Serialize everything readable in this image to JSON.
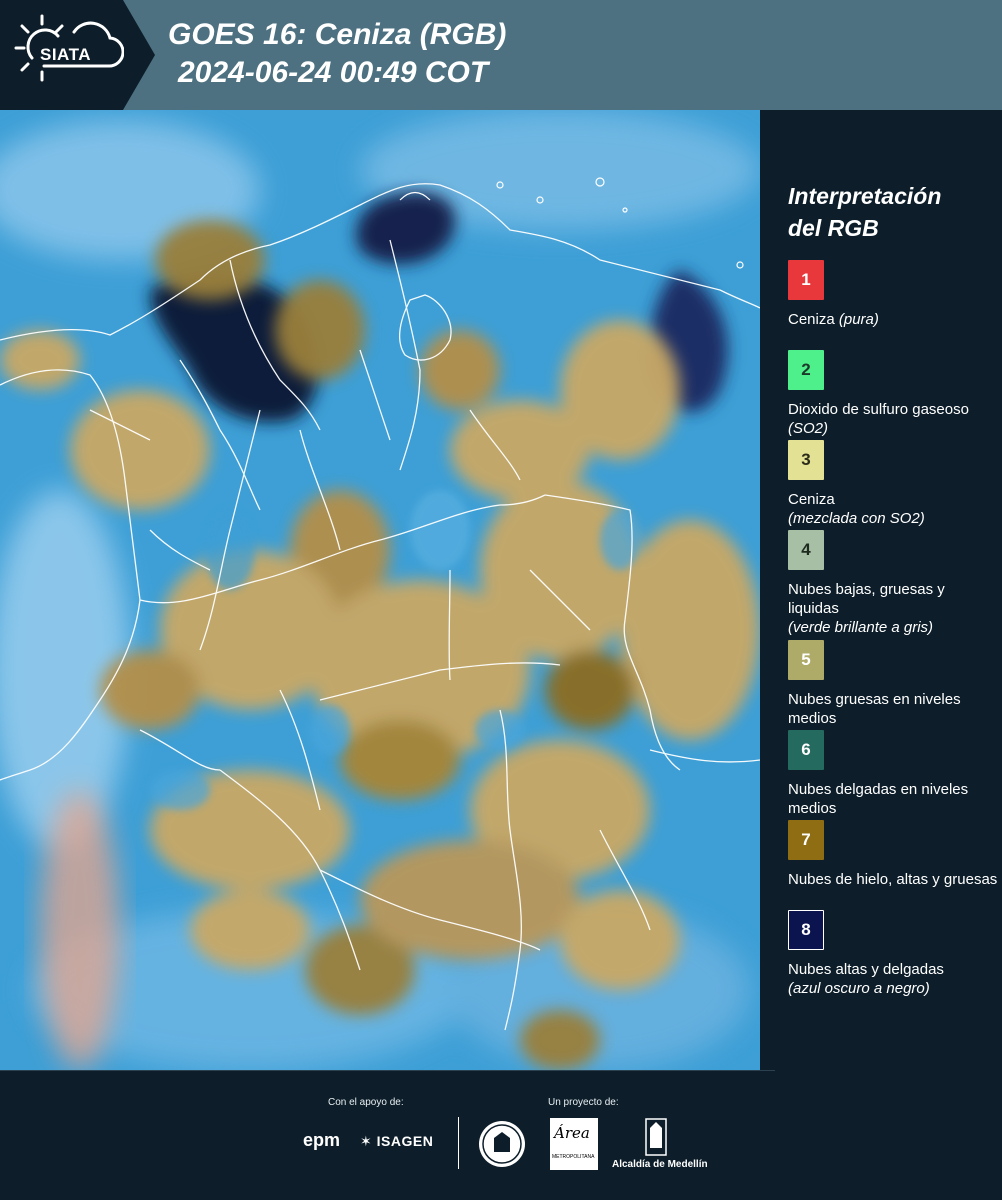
{
  "header": {
    "logo_label": "SIATA",
    "title_line1": "GOES 16: Ceniza (RGB)",
    "title_line2": "2024-06-24 00:49 COT"
  },
  "legend": {
    "title_line1": "Interpretación",
    "title_line2": "del RGB",
    "items": [
      {
        "number": "1",
        "color": "#e8383c",
        "text_color": "#ffffff",
        "label": "Ceniza",
        "note": "(pura)"
      },
      {
        "number": "2",
        "color": "#4ef08c",
        "text_color": "#1b3a2a",
        "label": "Dioxido de sulfuro gaseoso",
        "note": "(SO2)"
      },
      {
        "number": "3",
        "color": "#e3e193",
        "text_color": "#2b2b1a",
        "label": "Ceniza",
        "note": "(mezclada con SO2)"
      },
      {
        "number": "4",
        "color": "#a6bfa5",
        "text_color": "#1e2a1e",
        "label": "Nubes bajas, gruesas y liquidas",
        "note": "(verde brillante a gris)"
      },
      {
        "number": "5",
        "color": "#aeaa67",
        "text_color": "#ffffff",
        "label": "Nubes gruesas en niveles medios",
        "note": ""
      },
      {
        "number": "6",
        "color": "#246a5e",
        "text_color": "#ffffff",
        "label": "Nubes delgadas en niveles medios",
        "note": ""
      },
      {
        "number": "7",
        "color": "#8f6d12",
        "text_color": "#ffffff",
        "label": "Nubes de hielo, altas y gruesas",
        "note": ""
      },
      {
        "number": "8",
        "color": "#0c1450",
        "text_color": "#ffffff",
        "label": "Nubes altas y delgadas",
        "note": "(azul oscuro a negro)"
      }
    ]
  },
  "footer": {
    "support_label": "Con el apoyo de:",
    "project_label": "Un proyecto de:",
    "sponsor1": "epm",
    "sponsor2": "ISAGEN",
    "partner1_logo": "Área",
    "partner1_sub": "METROPOLITANA",
    "partner2": "Alcaldía de Medellín"
  },
  "map": {
    "ocean_color": "#3d9fd6",
    "cloud_tan_color": "#c9a865",
    "cloud_olive_color": "#9a7f3a",
    "dark_cloud_color": "#0c1a3a",
    "border_color": "#ffffff"
  }
}
